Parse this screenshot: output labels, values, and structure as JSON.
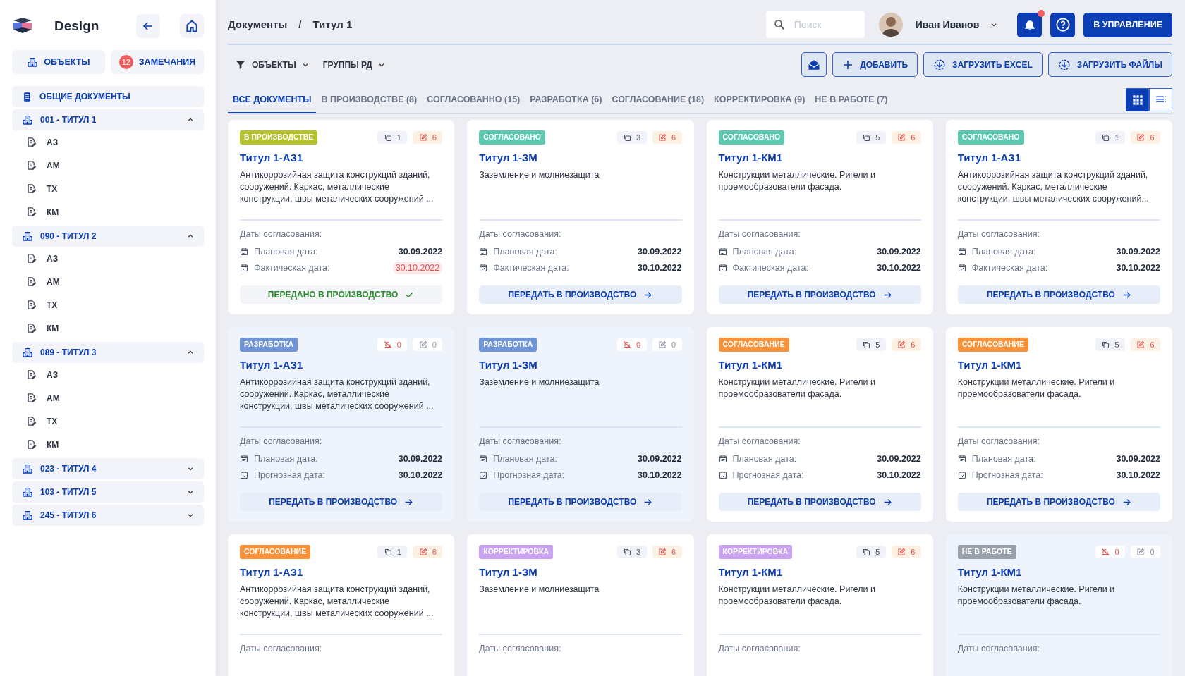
{
  "sidebar": {
    "logo_text": "Design",
    "nav_buttons": [
      {
        "kind": "objects",
        "label": "ОБЪЕКТЫ"
      },
      {
        "kind": "remarks",
        "label": "ЗАМЕЧАНИЯ",
        "badge": "12"
      }
    ],
    "tree": [
      {
        "kind": "section",
        "label": "ОБЩИЕ ДОКУМЕНТЫ"
      },
      {
        "kind": "group",
        "label": "001 - ТИТУЛ 1",
        "expanded": true,
        "children": [
          {
            "label": "АЗ"
          },
          {
            "label": "АМ"
          },
          {
            "label": "ТХ"
          },
          {
            "label": "КМ"
          }
        ]
      },
      {
        "kind": "group",
        "label": "090 - ТИТУЛ 2",
        "expanded": true,
        "children": [
          {
            "label": "АЗ"
          },
          {
            "label": "АМ"
          },
          {
            "label": "ТХ"
          },
          {
            "label": "КМ"
          }
        ]
      },
      {
        "kind": "group",
        "label": "089 - ТИТУЛ 3",
        "expanded": true,
        "children": [
          {
            "label": "АЗ"
          },
          {
            "label": "АМ"
          },
          {
            "label": "ТХ"
          },
          {
            "label": "КМ"
          }
        ]
      },
      {
        "kind": "group",
        "label": "023 - ТИТУЛ 4",
        "expanded": false
      },
      {
        "kind": "group",
        "label": "103 - ТИТУЛ 5",
        "expanded": false
      },
      {
        "kind": "group",
        "label": "245 - ТИТУЛ 6",
        "expanded": false
      }
    ]
  },
  "header": {
    "breadcrumbs": [
      "Документы",
      "Титул 1"
    ],
    "breadcrumb_separator": "/",
    "search": {
      "placeholder": "Поиск"
    },
    "user": {
      "name": "Иван Иванов"
    },
    "notifications": {
      "unread": true
    },
    "manage_button": "В УПРАВЛЕНИЕ"
  },
  "toolbar": {
    "filters": [
      {
        "kind": "filter",
        "label": "ОБЪЕКТЫ"
      },
      {
        "kind": "plain",
        "label": "ГРУППЫ РД"
      }
    ],
    "actions": [
      {
        "kind": "mail"
      },
      {
        "kind": "add",
        "label": "ДОБАВИТЬ"
      },
      {
        "kind": "upload",
        "label": "ЗАГРУЗИТЬ EXCEL"
      },
      {
        "kind": "upload",
        "label": "ЗАГРУЗИТЬ ФАЙЛЫ"
      }
    ]
  },
  "tabs": [
    {
      "label": "ВСЕ ДОКУМЕНТЫ",
      "selected": true
    },
    {
      "label": "В ПРОИЗВОДСТВЕ (8)",
      "selected": false
    },
    {
      "label": "СОГЛАСОВАННО (15)",
      "selected": false
    },
    {
      "label": "РАЗРАБОТКА (6)",
      "selected": false
    },
    {
      "label": "СОГЛАСОВАНИЕ (18)",
      "selected": false
    },
    {
      "label": "КОРРЕКТИРОВКА (9)",
      "selected": false
    },
    {
      "label": "НЕ В РАБОТЕ (7)",
      "selected": false
    }
  ],
  "view_modes": [
    {
      "kind": "grid",
      "selected": true
    },
    {
      "kind": "list",
      "selected": false
    }
  ],
  "cards": [
    {
      "status": "В ПРОИЗВОДСТВЕ",
      "color": "#b5c42e",
      "dimmed": false,
      "counters": [
        {
          "kind": "copies",
          "count": "1",
          "highlighted": false
        },
        {
          "kind": "edits",
          "count": "6",
          "highlighted": true
        }
      ],
      "title": "Титул 1-АЗ1",
      "description": "Антикоррозийная защита конструкций зданий, сооружений. Каркас, металлические конструкции, швы металических сооружений ...",
      "dates_label": "Даты согласования:",
      "dates": [
        {
          "kind": "plan",
          "label": "Плановая дата:",
          "value": "30.09.2022",
          "overdue": false
        },
        {
          "kind": "actual",
          "label": "Фактическая дата:",
          "value": "30.10.2022",
          "overdue": true
        }
      ],
      "action": {
        "kind": "done",
        "label": "ПЕРЕДАНО В ПРОИЗВОДСТВО"
      }
    },
    {
      "status": "СОГЛАСОВАНО",
      "color": "#5ec9b1",
      "dimmed": false,
      "counters": [
        {
          "kind": "copies",
          "count": "3",
          "highlighted": false
        },
        {
          "kind": "edits",
          "count": "6",
          "highlighted": true
        }
      ],
      "title": "Титул 1-ЗМ",
      "description": "Заземление и молниезащита",
      "dates_label": "Даты согласования:",
      "dates": [
        {
          "kind": "plan",
          "label": "Плановая дата:",
          "value": "30.09.2022",
          "overdue": false
        },
        {
          "kind": "actual",
          "label": "Фактическая дата:",
          "value": "30.10.2022",
          "overdue": false
        }
      ],
      "action": {
        "kind": "transfer",
        "label": "ПЕРЕДАТЬ В ПРОИЗВОДСТВО"
      }
    },
    {
      "status": "СОГЛАСОВАНО",
      "color": "#5ec9b1",
      "dimmed": false,
      "counters": [
        {
          "kind": "copies",
          "count": "5",
          "highlighted": false
        },
        {
          "kind": "edits",
          "count": "6",
          "highlighted": true
        }
      ],
      "title": "Титул 1-КМ1",
      "description": "Конструкции металлические. Ригели и проемообразователи фасада.",
      "dates_label": "Даты согласования:",
      "dates": [
        {
          "kind": "plan",
          "label": "Плановая дата:",
          "value": "30.09.2022",
          "overdue": false
        },
        {
          "kind": "actual",
          "label": "Фактическая дата:",
          "value": "30.10.2022",
          "overdue": false
        }
      ],
      "action": {
        "kind": "transfer",
        "label": "ПЕРЕДАТЬ В ПРОИЗВОДСТВО"
      }
    },
    {
      "status": "СОГЛАСОВАНО",
      "color": "#5ec9b1",
      "dimmed": false,
      "counters": [
        {
          "kind": "copies",
          "count": "1",
          "highlighted": false
        },
        {
          "kind": "edits",
          "count": "6",
          "highlighted": true
        }
      ],
      "title": "Титул 1-АЗ1",
      "description": "Антикоррозийная защита конструкций зданий, сооружений. Каркас, металлические конструкции, швы металических сооружений...",
      "dates_label": "Даты согласования:",
      "dates": [
        {
          "kind": "plan",
          "label": "Плановая дата:",
          "value": "30.09.2022",
          "overdue": false
        },
        {
          "kind": "actual",
          "label": "Фактическая дата:",
          "value": "30.10.2022",
          "overdue": false
        }
      ],
      "action": {
        "kind": "transfer",
        "label": "ПЕРЕДАТЬ В ПРОИЗВОДСТВО"
      }
    },
    {
      "status": "РАЗРАБОТКА",
      "color": "#6f95d6",
      "dimmed": true,
      "counters": [
        {
          "kind": "muted",
          "count": "0",
          "highlighted": true
        },
        {
          "kind": "edits",
          "count": "0",
          "highlighted": false
        }
      ],
      "title": "Титул 1-АЗ1",
      "description": "Антикоррозийная защита конструкций зданий, сооружений. Каркас, металлические конструкции, швы металических сооружений ...",
      "dates_label": "Даты согласования:",
      "dates": [
        {
          "kind": "plan",
          "label": "Плановая дата:",
          "value": "30.09.2022",
          "overdue": false
        },
        {
          "kind": "actual",
          "label": "Прогнозная дата:",
          "value": "30.10.2022",
          "overdue": false
        }
      ],
      "action": {
        "kind": "transfer",
        "label": "ПЕРЕДАТЬ В ПРОИЗВОДСТВО"
      }
    },
    {
      "status": "РАЗРАБОТКА",
      "color": "#6f95d6",
      "dimmed": true,
      "counters": [
        {
          "kind": "muted",
          "count": "0",
          "highlighted": true
        },
        {
          "kind": "edits",
          "count": "0",
          "highlighted": false
        }
      ],
      "title": "Титул 1-ЗМ",
      "description": "Заземление и молниезащита",
      "dates_label": "Даты согласования:",
      "dates": [
        {
          "kind": "plan",
          "label": "Плановая дата:",
          "value": "30.09.2022",
          "overdue": false
        },
        {
          "kind": "actual",
          "label": "Прогнозная дата:",
          "value": "30.10.2022",
          "overdue": false
        }
      ],
      "action": {
        "kind": "transfer",
        "label": "ПЕРЕДАТЬ В ПРОИЗВОДСТВО"
      }
    },
    {
      "status": "СОГЛАСОВАНИЕ",
      "color": "#f7923a",
      "dimmed": false,
      "counters": [
        {
          "kind": "copies",
          "count": "5",
          "highlighted": false
        },
        {
          "kind": "edits",
          "count": "6",
          "highlighted": true
        }
      ],
      "title": "Титул 1-КМ1",
      "description": "Конструкции металлические. Ригели и проемообразователи фасада.",
      "dates_label": "Даты согласования:",
      "dates": [
        {
          "kind": "plan",
          "label": "Плановая дата:",
          "value": "30.09.2022",
          "overdue": false
        },
        {
          "kind": "actual",
          "label": "Прогнозная дата:",
          "value": "30.10.2022",
          "overdue": false
        }
      ],
      "action": {
        "kind": "transfer",
        "label": "ПЕРЕДАТЬ В ПРОИЗВОДСТВО"
      }
    },
    {
      "status": "СОГЛАСОВАНИЕ",
      "color": "#f7923a",
      "dimmed": false,
      "counters": [
        {
          "kind": "copies",
          "count": "5",
          "highlighted": false
        },
        {
          "kind": "edits",
          "count": "6",
          "highlighted": true
        }
      ],
      "title": "Титул 1-КМ1",
      "description": "Конструкции металлические. Ригели и проемообразователи фасада.",
      "dates_label": "Даты согласования:",
      "dates": [
        {
          "kind": "plan",
          "label": "Плановая дата:",
          "value": "30.09.2022",
          "overdue": false
        },
        {
          "kind": "actual",
          "label": "Прогнозная дата:",
          "value": "30.10.2022",
          "overdue": false
        }
      ],
      "action": {
        "kind": "transfer",
        "label": "ПЕРЕДАТЬ В ПРОИЗВОДСТВО"
      }
    },
    {
      "status": "СОГЛАСОВАНИЕ",
      "color": "#f7923a",
      "dimmed": false,
      "counters": [
        {
          "kind": "copies",
          "count": "1",
          "highlighted": false
        },
        {
          "kind": "edits",
          "count": "6",
          "highlighted": true
        }
      ],
      "title": "Титул 1-АЗ1",
      "description": "Антикоррозийная защита конструкций зданий, сооружений. Каркас, металлические конструкции, швы металических сооружений ...",
      "dates_label": "Даты согласования:"
    },
    {
      "status": "КОРРЕКТИРОВКА",
      "color": "#c9a2f0",
      "dimmed": false,
      "counters": [
        {
          "kind": "copies",
          "count": "3",
          "highlighted": false
        },
        {
          "kind": "edits",
          "count": "6",
          "highlighted": true
        }
      ],
      "title": "Титул 1-ЗМ",
      "description": "Заземление и молниезащита",
      "dates_label": "Даты согласования:"
    },
    {
      "status": "КОРРЕКТИРОВКА",
      "color": "#c9a2f0",
      "dimmed": false,
      "counters": [
        {
          "kind": "copies",
          "count": "5",
          "highlighted": false
        },
        {
          "kind": "edits",
          "count": "6",
          "highlighted": true
        }
      ],
      "title": "Титул 1-КМ1",
      "description": "Конструкции металлические. Ригели и проемообразователи фасада.",
      "dates_label": "Даты согласования:"
    },
    {
      "status": "НЕ В РАБОТЕ",
      "color": "#9aa0a9",
      "dimmed": true,
      "counters": [
        {
          "kind": "muted",
          "count": "0",
          "highlighted": true
        },
        {
          "kind": "edits",
          "count": "0",
          "highlighted": false
        }
      ],
      "title": "Титул 1-КМ1",
      "description": "Конструкции металлические. Ригели и проемообразователи фасада.",
      "dates_label": "Даты согласования:"
    }
  ]
}
